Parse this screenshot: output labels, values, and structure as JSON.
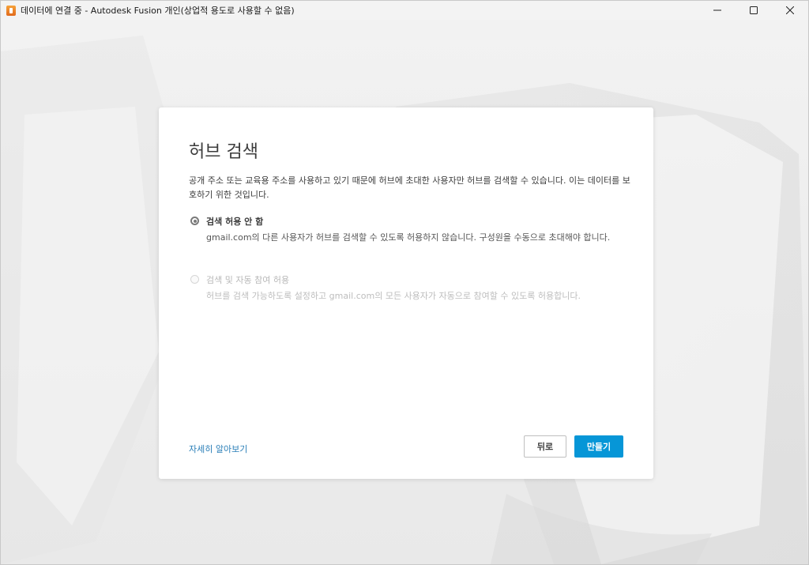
{
  "window": {
    "title": "데이터에 연결 중 - Autodesk Fusion 개인(상업적 용도로 사용할 수 없음)",
    "controls": {
      "minimize": "—",
      "maximize": "☐",
      "close": "✕"
    }
  },
  "dialog": {
    "title": "허브 검색",
    "description": "공개 주소 또는 교육용 주소를 사용하고 있기 때문에 허브에 초대한 사용자만 허브를 검색할 수 있습니다. 이는 데이터를 보호하기 위한 것입니다.",
    "options": [
      {
        "label": "검색 허용 안 함",
        "description": "gmail.com의 다른 사용자가 허브를 검색할 수 있도록 허용하지 않습니다. 구성원을 수동으로 초대해야 합니다.",
        "selected": true,
        "enabled": true
      },
      {
        "label": "검색 및 자동 참여 허용",
        "description": "허브를 검색 가능하도록 설정하고 gmail.com의 모든 사용자가 자동으로 참여할 수 있도록 허용합니다.",
        "selected": false,
        "enabled": false
      }
    ],
    "learn_more": "자세히 알아보기",
    "back_label": "뒤로",
    "create_label": "만들기"
  },
  "colors": {
    "accent": "#0696d7",
    "link": "#2b7fb8"
  }
}
